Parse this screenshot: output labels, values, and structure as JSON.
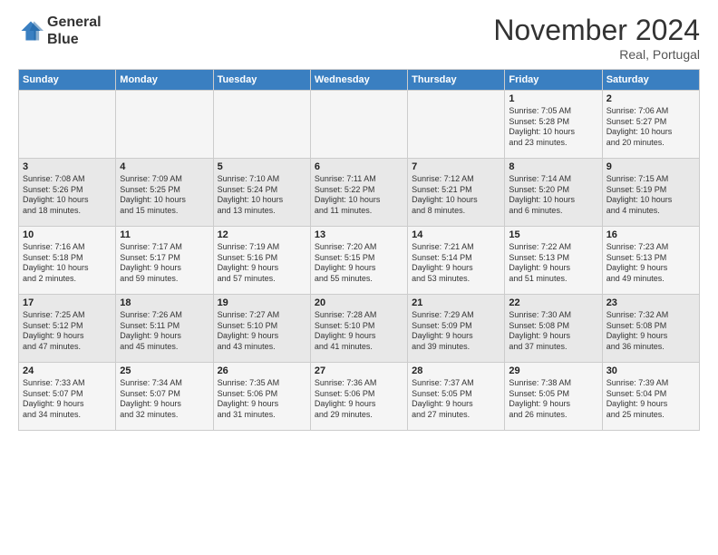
{
  "header": {
    "logo_line1": "General",
    "logo_line2": "Blue",
    "month": "November 2024",
    "location": "Real, Portugal"
  },
  "weekdays": [
    "Sunday",
    "Monday",
    "Tuesday",
    "Wednesday",
    "Thursday",
    "Friday",
    "Saturday"
  ],
  "weeks": [
    [
      {
        "day": "",
        "info": ""
      },
      {
        "day": "",
        "info": ""
      },
      {
        "day": "",
        "info": ""
      },
      {
        "day": "",
        "info": ""
      },
      {
        "day": "",
        "info": ""
      },
      {
        "day": "1",
        "info": "Sunrise: 7:05 AM\nSunset: 5:28 PM\nDaylight: 10 hours\nand 23 minutes."
      },
      {
        "day": "2",
        "info": "Sunrise: 7:06 AM\nSunset: 5:27 PM\nDaylight: 10 hours\nand 20 minutes."
      }
    ],
    [
      {
        "day": "3",
        "info": "Sunrise: 7:08 AM\nSunset: 5:26 PM\nDaylight: 10 hours\nand 18 minutes."
      },
      {
        "day": "4",
        "info": "Sunrise: 7:09 AM\nSunset: 5:25 PM\nDaylight: 10 hours\nand 15 minutes."
      },
      {
        "day": "5",
        "info": "Sunrise: 7:10 AM\nSunset: 5:24 PM\nDaylight: 10 hours\nand 13 minutes."
      },
      {
        "day": "6",
        "info": "Sunrise: 7:11 AM\nSunset: 5:22 PM\nDaylight: 10 hours\nand 11 minutes."
      },
      {
        "day": "7",
        "info": "Sunrise: 7:12 AM\nSunset: 5:21 PM\nDaylight: 10 hours\nand 8 minutes."
      },
      {
        "day": "8",
        "info": "Sunrise: 7:14 AM\nSunset: 5:20 PM\nDaylight: 10 hours\nand 6 minutes."
      },
      {
        "day": "9",
        "info": "Sunrise: 7:15 AM\nSunset: 5:19 PM\nDaylight: 10 hours\nand 4 minutes."
      }
    ],
    [
      {
        "day": "10",
        "info": "Sunrise: 7:16 AM\nSunset: 5:18 PM\nDaylight: 10 hours\nand 2 minutes."
      },
      {
        "day": "11",
        "info": "Sunrise: 7:17 AM\nSunset: 5:17 PM\nDaylight: 9 hours\nand 59 minutes."
      },
      {
        "day": "12",
        "info": "Sunrise: 7:19 AM\nSunset: 5:16 PM\nDaylight: 9 hours\nand 57 minutes."
      },
      {
        "day": "13",
        "info": "Sunrise: 7:20 AM\nSunset: 5:15 PM\nDaylight: 9 hours\nand 55 minutes."
      },
      {
        "day": "14",
        "info": "Sunrise: 7:21 AM\nSunset: 5:14 PM\nDaylight: 9 hours\nand 53 minutes."
      },
      {
        "day": "15",
        "info": "Sunrise: 7:22 AM\nSunset: 5:13 PM\nDaylight: 9 hours\nand 51 minutes."
      },
      {
        "day": "16",
        "info": "Sunrise: 7:23 AM\nSunset: 5:13 PM\nDaylight: 9 hours\nand 49 minutes."
      }
    ],
    [
      {
        "day": "17",
        "info": "Sunrise: 7:25 AM\nSunset: 5:12 PM\nDaylight: 9 hours\nand 47 minutes."
      },
      {
        "day": "18",
        "info": "Sunrise: 7:26 AM\nSunset: 5:11 PM\nDaylight: 9 hours\nand 45 minutes."
      },
      {
        "day": "19",
        "info": "Sunrise: 7:27 AM\nSunset: 5:10 PM\nDaylight: 9 hours\nand 43 minutes."
      },
      {
        "day": "20",
        "info": "Sunrise: 7:28 AM\nSunset: 5:10 PM\nDaylight: 9 hours\nand 41 minutes."
      },
      {
        "day": "21",
        "info": "Sunrise: 7:29 AM\nSunset: 5:09 PM\nDaylight: 9 hours\nand 39 minutes."
      },
      {
        "day": "22",
        "info": "Sunrise: 7:30 AM\nSunset: 5:08 PM\nDaylight: 9 hours\nand 37 minutes."
      },
      {
        "day": "23",
        "info": "Sunrise: 7:32 AM\nSunset: 5:08 PM\nDaylight: 9 hours\nand 36 minutes."
      }
    ],
    [
      {
        "day": "24",
        "info": "Sunrise: 7:33 AM\nSunset: 5:07 PM\nDaylight: 9 hours\nand 34 minutes."
      },
      {
        "day": "25",
        "info": "Sunrise: 7:34 AM\nSunset: 5:07 PM\nDaylight: 9 hours\nand 32 minutes."
      },
      {
        "day": "26",
        "info": "Sunrise: 7:35 AM\nSunset: 5:06 PM\nDaylight: 9 hours\nand 31 minutes."
      },
      {
        "day": "27",
        "info": "Sunrise: 7:36 AM\nSunset: 5:06 PM\nDaylight: 9 hours\nand 29 minutes."
      },
      {
        "day": "28",
        "info": "Sunrise: 7:37 AM\nSunset: 5:05 PM\nDaylight: 9 hours\nand 27 minutes."
      },
      {
        "day": "29",
        "info": "Sunrise: 7:38 AM\nSunset: 5:05 PM\nDaylight: 9 hours\nand 26 minutes."
      },
      {
        "day": "30",
        "info": "Sunrise: 7:39 AM\nSunset: 5:04 PM\nDaylight: 9 hours\nand 25 minutes."
      }
    ]
  ]
}
